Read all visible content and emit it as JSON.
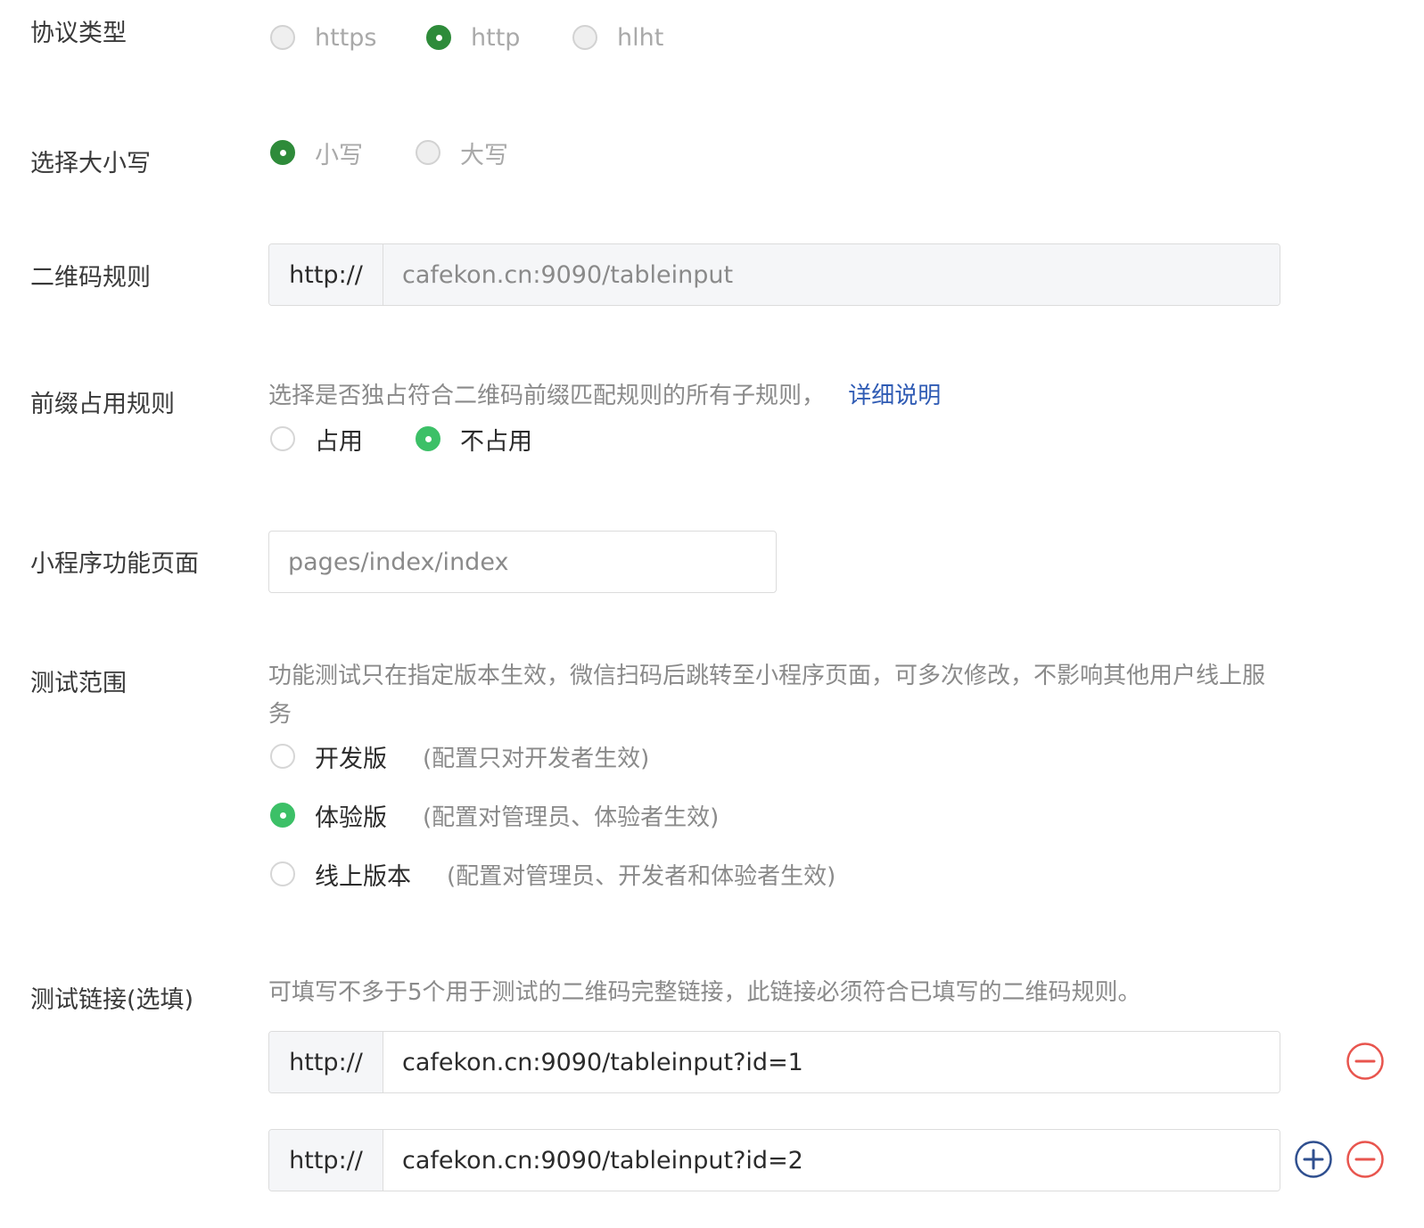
{
  "protocol": {
    "label": "协议类型",
    "options": [
      "https",
      "http",
      "hlht"
    ],
    "selected": "http"
  },
  "case_select": {
    "label": "选择大小写",
    "options": [
      "小写",
      "大写"
    ],
    "selected": "小写"
  },
  "qr_rule": {
    "label": "二维码规则",
    "prefix": "http://",
    "value": "cafekon.cn:9090/tableinput"
  },
  "prefix_rule": {
    "label": "前缀占用规则",
    "hint": "选择是否独占符合二维码前缀匹配规则的所有子规则，",
    "link": "详细说明",
    "options": [
      "占用",
      "不占用"
    ],
    "selected": "不占用"
  },
  "mini_page": {
    "label": "小程序功能页面",
    "placeholder": "pages/index/index"
  },
  "test_scope": {
    "label": "测试范围",
    "hint": "功能测试只在指定版本生效，微信扫码后跳转至小程序页面，可多次修改，不影响其他用户线上服务",
    "options": [
      {
        "label": "开发版",
        "note": "(配置只对开发者生效)"
      },
      {
        "label": "体验版",
        "note": "(配置对管理员、体验者生效)"
      },
      {
        "label": "线上版本",
        "note": "(配置对管理员、开发者和体验者生效)"
      }
    ],
    "selected": "体验版"
  },
  "test_links": {
    "label": "测试链接(选填)",
    "hint": "可填写不多于5个用于测试的二维码完整链接，此链接必须符合已填写的二维码规则。",
    "items": [
      {
        "prefix": "http://",
        "value": "cafekon.cn:9090/tableinput?id=1"
      },
      {
        "prefix": "http://",
        "value": "cafekon.cn:9090/tableinput?id=2"
      }
    ]
  },
  "colors": {
    "selected_dark": "#2e8b3a",
    "selected_bright": "#3cc067",
    "link": "#2f5bb4",
    "remove": "#e8554e",
    "add": "#2f4f8f"
  },
  "icons": [
    "remove-circle-icon",
    "add-circle-icon"
  ]
}
